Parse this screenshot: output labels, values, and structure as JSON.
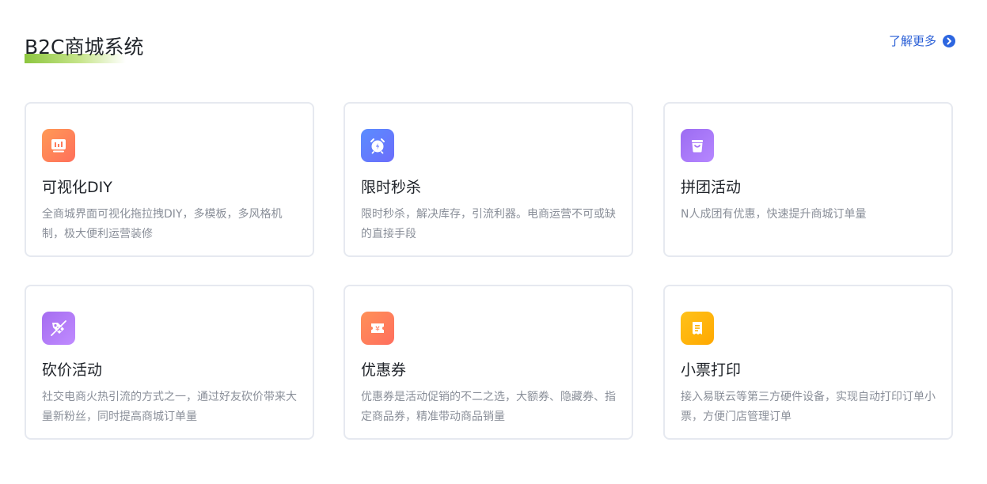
{
  "header": {
    "title": "B2C商城系统",
    "learn_more_label": "了解更多"
  },
  "cards": [
    {
      "icon": "chart-board-icon",
      "title": "可视化DIY",
      "desc": "全商城界面可视化拖拉拽DIY，多模板，多风格机制，极大便利运营装修"
    },
    {
      "icon": "alarm-clock-icon",
      "title": "限时秒杀",
      "desc": "限时秒杀，解决库存，引流利器。电商运营不可或缺的直接手段"
    },
    {
      "icon": "shopping-bag-icon",
      "title": "拼团活动",
      "desc": "N人成团有优惠，快速提升商城订单量"
    },
    {
      "icon": "price-tag-icon",
      "title": "砍价活动",
      "desc": "社交电商火热引流的方式之一，通过好友砍价带来大量新粉丝，同时提高商城订单量"
    },
    {
      "icon": "coupon-ticket-icon",
      "title": "优惠券",
      "desc": "优惠券是活动促销的不二之选，大额券、隐藏券、指定商品券，精准带动商品销量"
    },
    {
      "icon": "receipt-icon",
      "title": "小票打印",
      "desc": "接入易联云等第三方硬件设备，实现自动打印订单小票，方便门店管理订单"
    }
  ],
  "colors": {
    "accent": "#2d66e0",
    "title_underline": "#8dc63f",
    "card_border": "#e6e9f0",
    "desc_text": "#8a8f99"
  }
}
